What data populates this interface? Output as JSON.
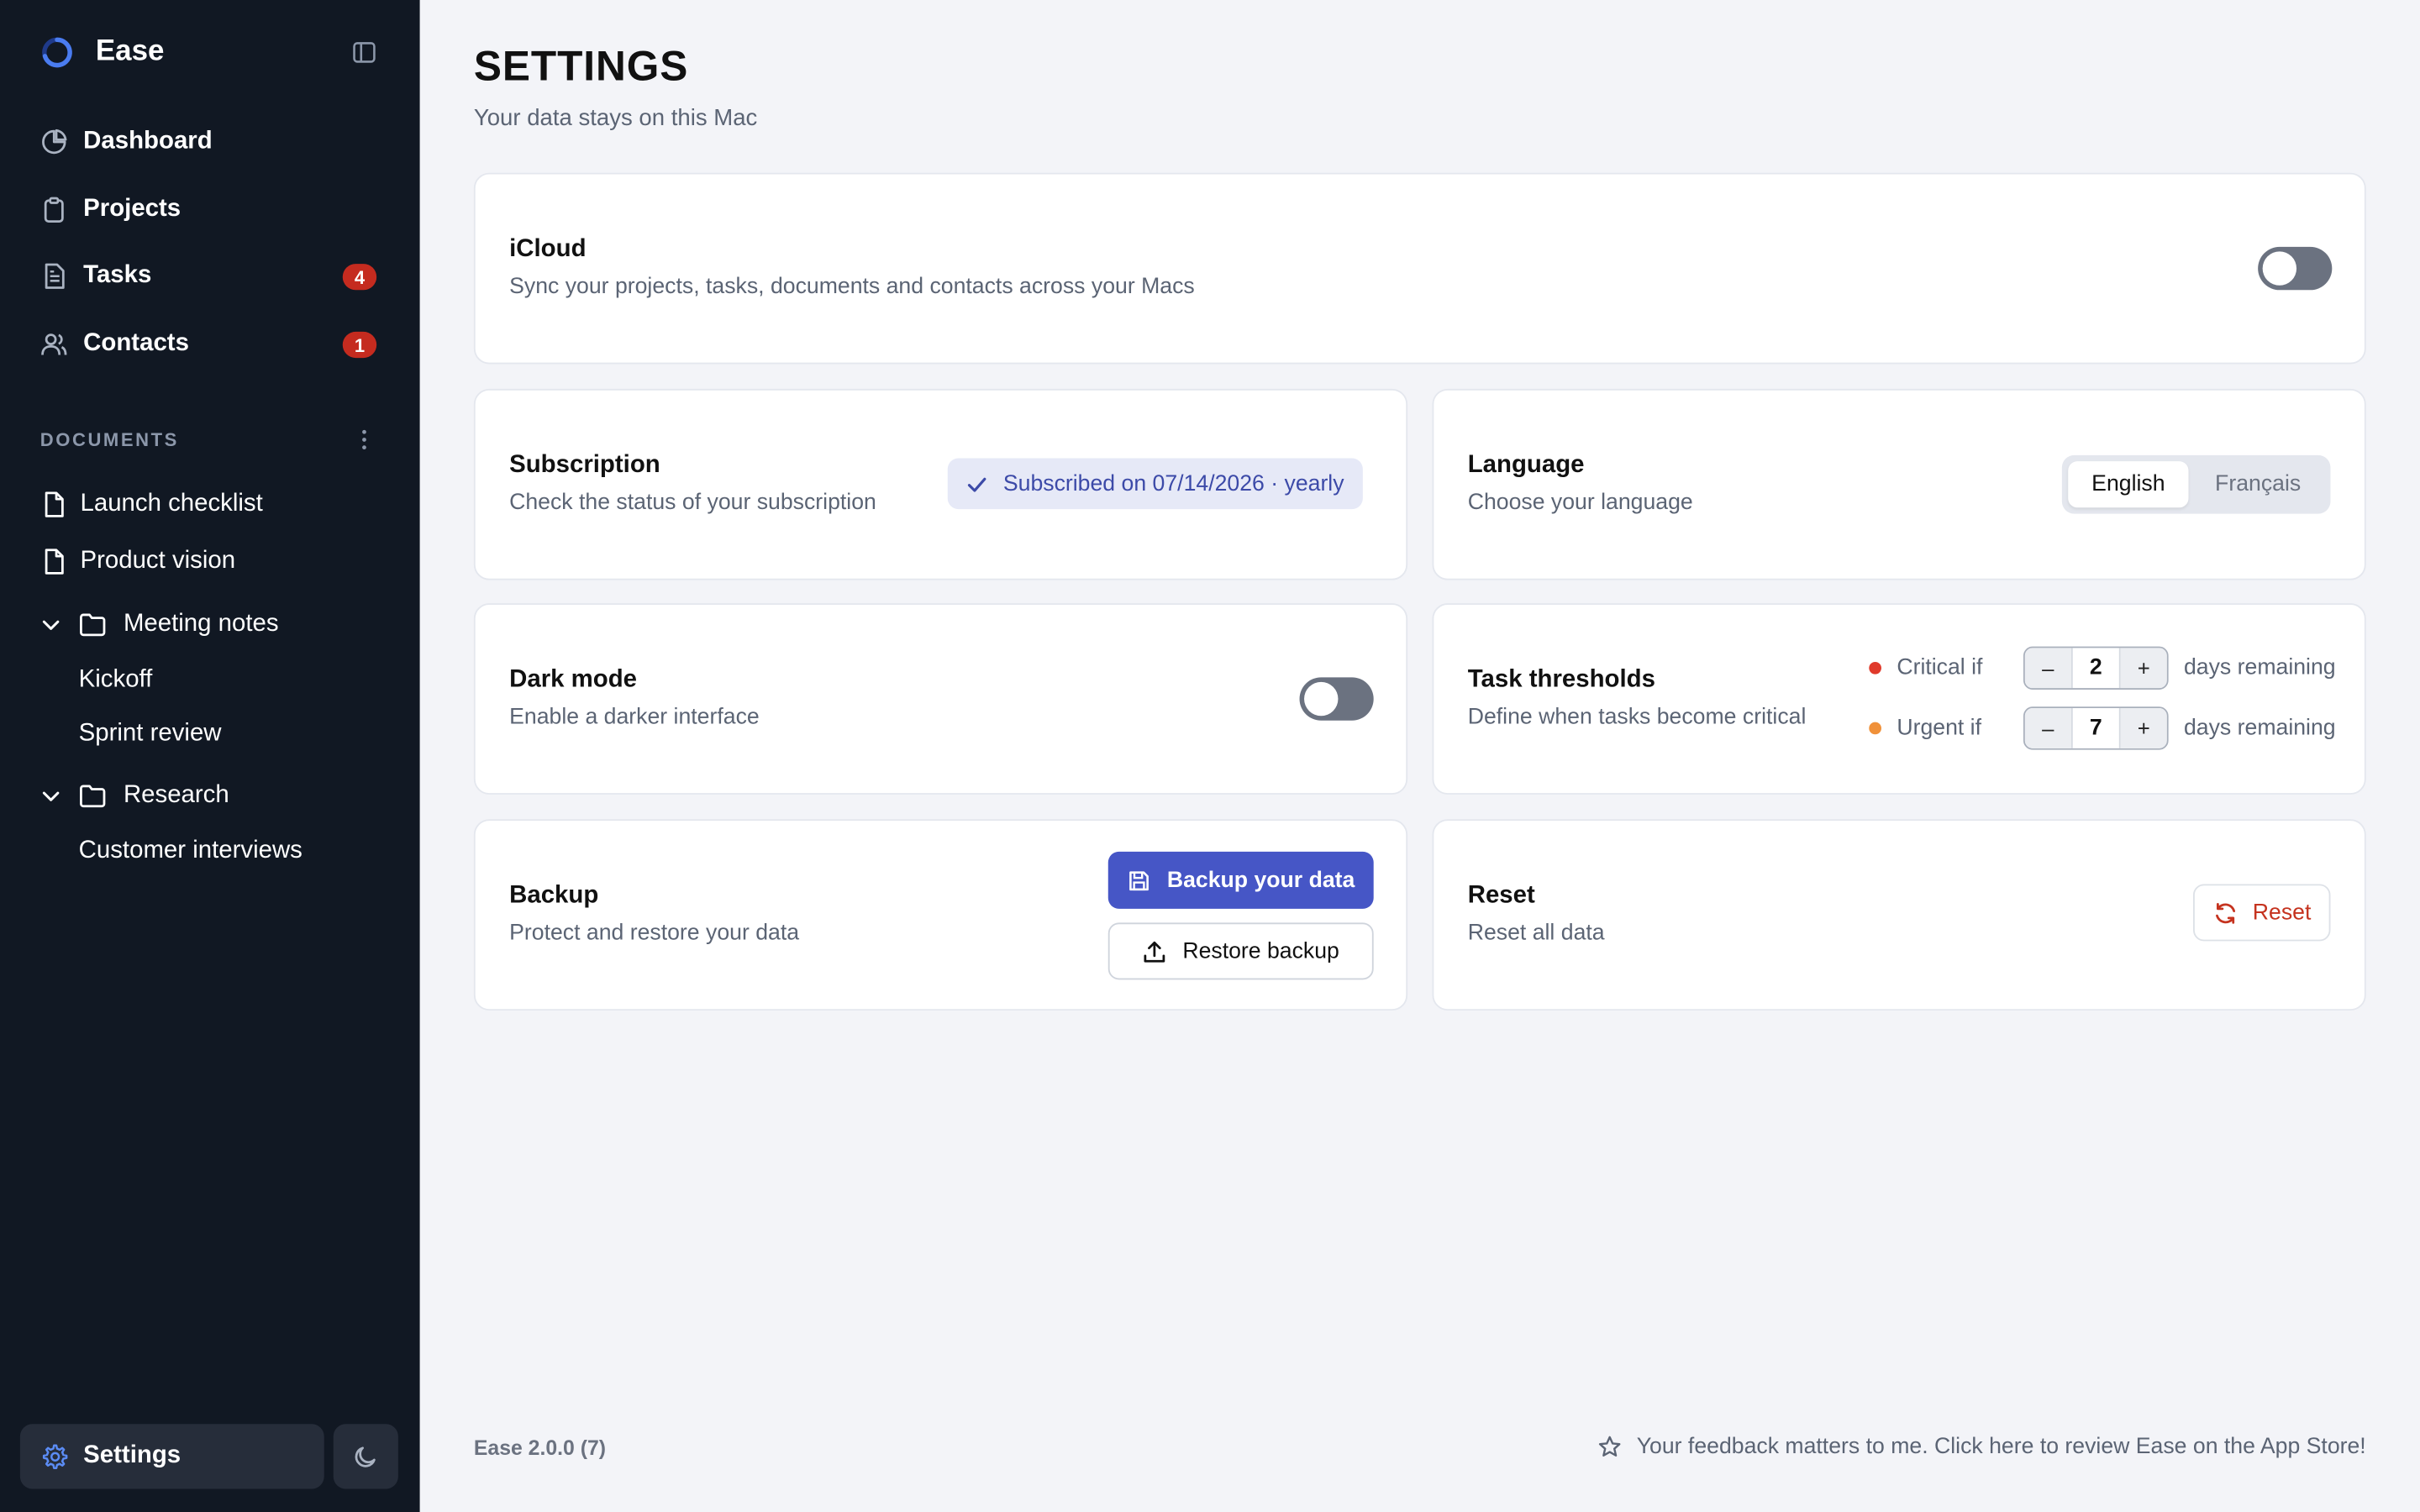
{
  "app": {
    "name": "Ease"
  },
  "sidebar": {
    "nav": [
      {
        "label": "Dashboard",
        "icon": "pie-chart-icon"
      },
      {
        "label": "Projects",
        "icon": "clipboard-icon"
      },
      {
        "label": "Tasks",
        "icon": "document-list-icon",
        "badge": "4"
      },
      {
        "label": "Contacts",
        "icon": "users-icon",
        "badge": "1"
      }
    ],
    "documents_title": "DOCUMENTS",
    "documents": {
      "launch": "Launch checklist",
      "vision": "Product vision",
      "meeting_notes": "Meeting notes",
      "kickoff": "Kickoff",
      "sprint_review": "Sprint review",
      "research": "Research",
      "customer_interviews": "Customer interviews"
    },
    "settings_label": "Settings"
  },
  "page": {
    "title": "SETTINGS",
    "subtitle": "Your data stays on this Mac"
  },
  "icloud": {
    "title": "iCloud",
    "desc": "Sync your projects, tasks, documents and contacts across your Macs",
    "enabled": false
  },
  "subscription": {
    "title": "Subscription",
    "desc": "Check the status of your subscription",
    "status": "Subscribed on 07/14/2026 · yearly"
  },
  "language": {
    "title": "Language",
    "desc": "Choose your language",
    "options": [
      "English",
      "Français"
    ],
    "selected": "English"
  },
  "dark_mode": {
    "title": "Dark mode",
    "desc": "Enable a darker interface",
    "enabled": false
  },
  "thresholds": {
    "title": "Task thresholds",
    "desc": "Define when tasks become critical",
    "critical_label": "Critical if",
    "critical_value": "2",
    "urgent_label": "Urgent if",
    "urgent_value": "7",
    "suffix": "days remaining",
    "minus": "–",
    "plus": "+"
  },
  "backup": {
    "title": "Backup",
    "desc": "Protect and restore your data",
    "backup_label": "Backup your data",
    "restore_label": "Restore backup"
  },
  "reset": {
    "title": "Reset",
    "desc": "Reset all data",
    "button_label": "Reset"
  },
  "footer": {
    "version": "Ease 2.0.0 (7)",
    "feedback": "Your feedback matters to me. Click here to review Ease on the App Store!"
  },
  "colors": {
    "sidebar_bg": "#111823",
    "accent": "#4656c6",
    "badge": "#c52b1f",
    "critical": "#e03a2b",
    "urgent": "#f0913a",
    "reset_text": "#c5331f"
  }
}
